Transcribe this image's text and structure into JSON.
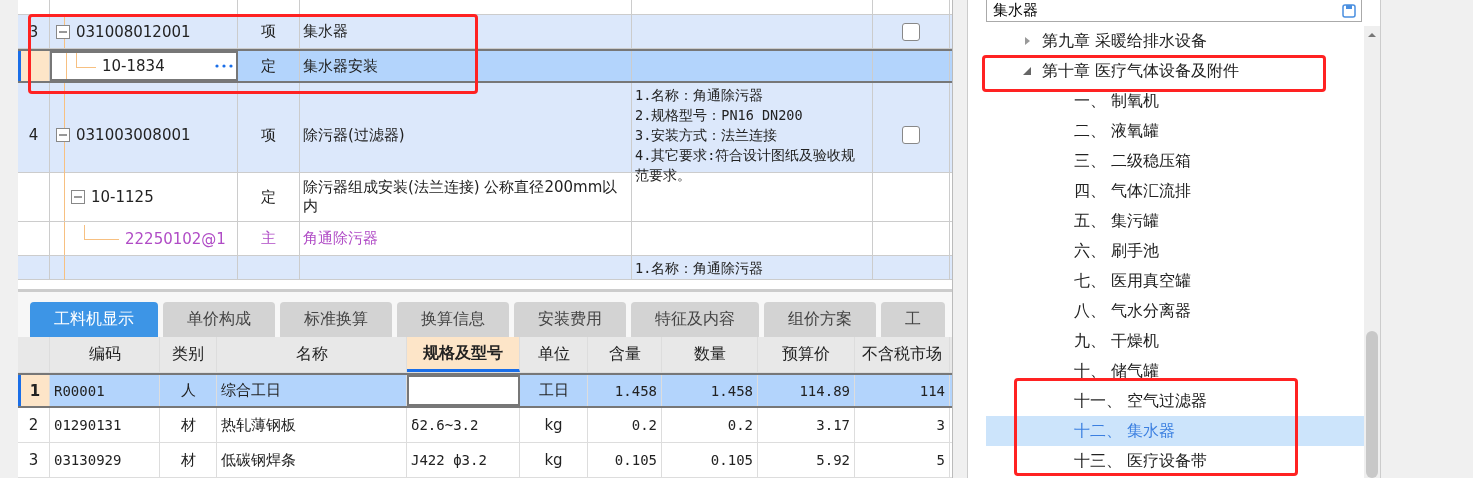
{
  "grid": {
    "rows": [
      {
        "kind": "item",
        "number": "3",
        "code": "031008012001",
        "type": "项",
        "name": "集水器",
        "checked": false,
        "selected": false,
        "expanded": true,
        "children": [
          {
            "kind": "quota",
            "code": "10-1834",
            "type": "定",
            "name": "集水器安装",
            "selected": true
          }
        ]
      },
      {
        "kind": "item",
        "number": "4",
        "code": "031003008001",
        "type": "项",
        "name": "除污器(过滤器)",
        "features": "1.名称：角通除污器\n2.规格型号：PN16 DN200\n3.安装方式：法兰连接\n4.其它要求:符合设计图纸及验收规范要求。",
        "checked": false,
        "selected": false,
        "expanded": true,
        "children": [
          {
            "kind": "quota",
            "code": "10-1125",
            "type": "定",
            "name": "除污器组成安装(法兰连接) 公称直径200mm以内",
            "selected": false,
            "expanded": true,
            "children": [
              {
                "kind": "material",
                "code": "22250102@1",
                "type": "主",
                "name": "角通除污器",
                "selected": false
              }
            ]
          }
        ]
      },
      {
        "kind": "item",
        "features": "1.名称：角通除污器",
        "selected": false
      }
    ]
  },
  "tabs": [
    {
      "label": "工料机显示",
      "selected": true
    },
    {
      "label": "单价构成",
      "selected": false
    },
    {
      "label": "标准换算",
      "selected": false
    },
    {
      "label": "换算信息",
      "selected": false
    },
    {
      "label": "安装费用",
      "selected": false
    },
    {
      "label": "特征及内容",
      "selected": false
    },
    {
      "label": "组价方案",
      "selected": false
    },
    {
      "label": "工",
      "selected": false
    }
  ],
  "table": {
    "columns": [
      {
        "label": "编码",
        "active": false
      },
      {
        "label": "类别",
        "active": false
      },
      {
        "label": "名称",
        "active": false
      },
      {
        "label": "规格及型号",
        "active": true
      },
      {
        "label": "单位",
        "active": false
      },
      {
        "label": "含量",
        "active": false
      },
      {
        "label": "数量",
        "active": false
      },
      {
        "label": "预算价",
        "active": false
      },
      {
        "label": "不含税市场",
        "active": false
      }
    ],
    "rows": [
      {
        "number": "1",
        "cells": [
          "R00001",
          "人",
          "综合工日",
          null,
          "工日",
          "1.458",
          "1.458",
          "114.89",
          "114"
        ],
        "selected": true
      },
      {
        "number": "2",
        "cells": [
          "01290131",
          "材",
          "热轧薄钢板",
          "δ2.6~3.2",
          "kg",
          "0.2",
          "0.2",
          "3.17",
          "3"
        ],
        "selected": false
      },
      {
        "number": "3",
        "cells": [
          "03130929",
          "材",
          "低碳钢焊条",
          "J422 ф3.2",
          "kg",
          "0.105",
          "0.105",
          "5.92",
          "5"
        ],
        "selected": false
      }
    ]
  },
  "search": {
    "value": "集水器"
  },
  "tree": [
    {
      "label": "第九章 采暖给排水设备",
      "expanded": false
    },
    {
      "label": "第十章 医疗气体设备及附件",
      "expanded": true,
      "children": [
        {
          "label": "一、 制氧机",
          "selected": false
        },
        {
          "label": "二、 液氧罐",
          "selected": false
        },
        {
          "label": "三、 二级稳压箱",
          "selected": false
        },
        {
          "label": "四、 气体汇流排",
          "selected": false
        },
        {
          "label": "五、 集污罐",
          "selected": false
        },
        {
          "label": "六、 刷手池",
          "selected": false
        },
        {
          "label": "七、 医用真空罐",
          "selected": false
        },
        {
          "label": "八、 气水分离器",
          "selected": false
        },
        {
          "label": "九、 干燥机",
          "selected": false
        },
        {
          "label": "十、 储气罐",
          "selected": false
        },
        {
          "label": "十一、 空气过滤器",
          "selected": false
        },
        {
          "label": "十二、 集水器",
          "selected": true
        },
        {
          "label": "十三、 医疗设备带",
          "selected": false
        }
      ]
    }
  ]
}
